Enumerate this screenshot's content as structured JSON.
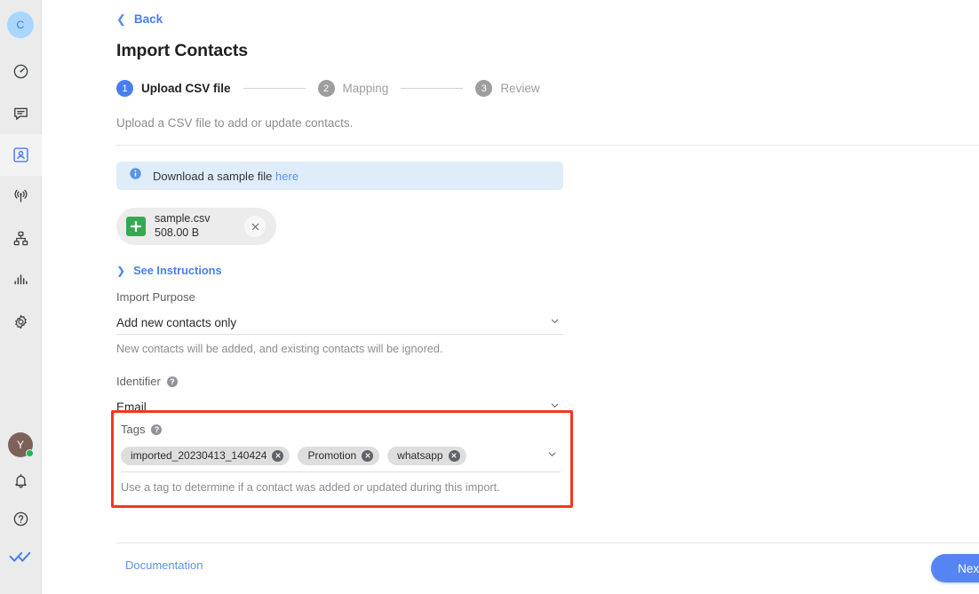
{
  "sidebar": {
    "account_initial": "C",
    "nav": [
      {
        "name": "dashboard-icon",
        "label": "Dashboard",
        "active": false
      },
      {
        "name": "chat-icon",
        "label": "Conversations",
        "active": false
      },
      {
        "name": "contacts-icon",
        "label": "Contacts",
        "active": true
      },
      {
        "name": "broadcast-icon",
        "label": "Broadcasts",
        "active": false
      },
      {
        "name": "flow-icon",
        "label": "Flow Builder",
        "active": false
      },
      {
        "name": "analytics-icon",
        "label": "Analytics",
        "active": false
      },
      {
        "name": "settings-icon",
        "label": "Settings",
        "active": false
      }
    ],
    "user_initial": "Y",
    "status": "online",
    "bottom": [
      {
        "name": "bell-icon",
        "label": "Notifications"
      },
      {
        "name": "help-circle-icon",
        "label": "Help"
      },
      {
        "name": "double-check-logo",
        "label": "App logo"
      }
    ]
  },
  "header": {
    "back_label": "Back",
    "back_icon": "chevron-left-icon",
    "title": "Import Contacts",
    "subtitle": "Upload a CSV file to add or update contacts."
  },
  "stepper": {
    "steps": [
      {
        "number": "1",
        "label": "Upload CSV file",
        "active": true
      },
      {
        "number": "2",
        "label": "Mapping",
        "active": false
      },
      {
        "number": "3",
        "label": "Review",
        "active": false
      }
    ]
  },
  "banner": {
    "icon": "info-icon",
    "text": "Download a sample file ",
    "link_label": "here"
  },
  "file": {
    "icon": "spreadsheet-icon",
    "name": "sample.csv",
    "size": "508.00 B",
    "remove_icon": "close-icon"
  },
  "instructions": {
    "icon": "chevron-right-icon",
    "label": "See Instructions"
  },
  "import_purpose": {
    "label": "Import Purpose",
    "value": "Add new contacts only",
    "hint": "New contacts will be added, and existing contacts will be ignored.",
    "chevron": "chevron-down-icon"
  },
  "identifier": {
    "label": "Identifier",
    "help_icon": "help-icon",
    "help_glyph": "?",
    "value": "Email",
    "chevron": "chevron-down-icon"
  },
  "tags": {
    "label": "Tags",
    "help_icon": "help-icon",
    "help_glyph": "?",
    "chips": [
      {
        "label": "imported_20230413_140424",
        "remove_icon": "close-icon"
      },
      {
        "label": "Promotion",
        "remove_icon": "close-icon"
      },
      {
        "label": "whatsapp",
        "remove_icon": "close-icon"
      }
    ],
    "chevron": "chevron-down-icon",
    "hint": "Use a tag to determine if a contact was added or updated during this import.",
    "highlight_color": "#f4371f"
  },
  "footer": {
    "documentation_label": "Documentation",
    "next_label": "Next"
  },
  "colors": {
    "accent_blue": "#4a7ef0",
    "next_button": "#5585f2",
    "banner_bg": "#dfedfb",
    "chip_bg": "#dedede",
    "inactive_step": "#9e9e9e",
    "file_icon_green": "#34a853",
    "online_green": "#1db954"
  }
}
